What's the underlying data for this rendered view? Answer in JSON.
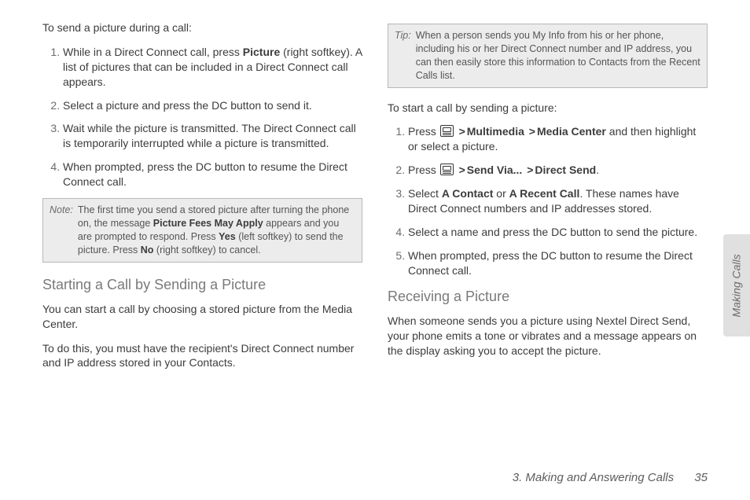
{
  "left": {
    "intro": "To send a picture during a call:",
    "steps": {
      "s1a": "While in a Direct Connect call, press ",
      "s1b": "Picture",
      "s1c": " (right softkey). A list of pictures that can be included in a Direct Connect call appears.",
      "s2": "Select a picture and press the DC button to send it.",
      "s3": "Wait while the picture is transmitted. The Direct Connect call is temporarily interrupted while a picture is transmitted.",
      "s4": "When prompted, press the DC button to resume the Direct Connect call."
    },
    "note": {
      "label": "Note:",
      "a": "The first time you send a stored picture after turning the phone on, the message ",
      "b": "Picture Fees May Apply",
      "c": " appears and you are prompted to respond. Press ",
      "d": "Yes",
      "e": " (left softkey) to send the picture. Press ",
      "f": "No",
      "g": " (right softkey) to cancel."
    },
    "h2": "Starting a Call by Sending a Picture",
    "p1": "You can start a call by choosing a stored picture from the Media Center.",
    "p2": "To do this, you must have the recipient's Direct Connect number and IP address stored in your Contacts."
  },
  "right": {
    "tip": {
      "label": "Tip:",
      "body": "When a person sends you My Info from his or her phone, including his or her Direct Connect number and IP address, you can then easily store this information to Contacts from the Recent Calls list."
    },
    "intro": "To start a call by sending a picture:",
    "steps": {
      "s1a": "Press ",
      "s1b": "Multimedia",
      "s1c": "Media Center",
      "s1d": " and then highlight or select a picture.",
      "s2a": "Press ",
      "s2b": "Send Via...",
      "s2c": "Direct Send",
      "s3a": "Select ",
      "s3b": "A Contact",
      "s3c": " or ",
      "s3d": "A Recent Call",
      "s3e": ". These names have Direct Connect numbers and IP addresses stored.",
      "s4": "Select a name and press the DC button to send the picture.",
      "s5": "When prompted, press the DC button to resume the Direct Connect call."
    },
    "h2": "Receiving a Picture",
    "p1": "When someone sends you a picture using Nextel Direct Send, your phone emits a tone or vibrates and a message appears on the display asking you to accept the picture."
  },
  "gt": ">",
  "period": ".",
  "sideTab": "Making Calls",
  "footer": {
    "title": "3. Making and Answering Calls",
    "page": "35"
  }
}
